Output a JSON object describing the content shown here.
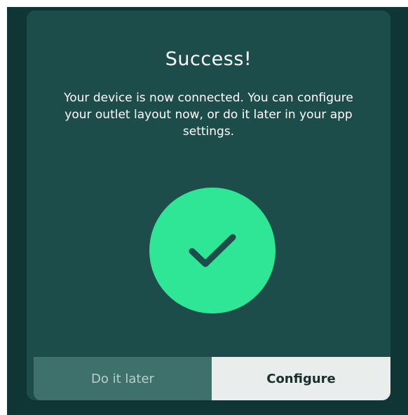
{
  "dialog": {
    "title": "Success!",
    "message": "Your device is now connected. You can configure your outlet layout now, or do it later in your app settings.",
    "status_icon": "checkmark-icon",
    "buttons": {
      "later_label": "Do it later",
      "configure_label": "Configure"
    }
  },
  "colors": {
    "backdrop": "#0f3535",
    "dialog_background": "#1c4d4a",
    "success_accent": "#2fe697",
    "checkmark": "#1c4d4a",
    "secondary_button": "#3f716c",
    "primary_button": "#e9edec"
  }
}
